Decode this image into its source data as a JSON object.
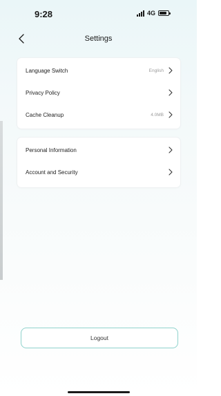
{
  "status_bar": {
    "time": "9:28",
    "network": "4G",
    "signal_icon": "signal-icon",
    "battery_icon": "battery-icon"
  },
  "header": {
    "title": "Settings",
    "back_icon": "chevron-left-icon"
  },
  "groups": [
    {
      "items": [
        {
          "label": "Language Switch",
          "value": "English"
        },
        {
          "label": "Privacy Policy",
          "value": ""
        },
        {
          "label": "Cache Cleanup",
          "value": "4.0MB"
        }
      ]
    },
    {
      "items": [
        {
          "label": "Personal Information",
          "value": ""
        },
        {
          "label": "Account and Security",
          "value": ""
        }
      ]
    }
  ],
  "logout_label": "Logout",
  "colors": {
    "accent_border": "#8fd2cc",
    "background_top": "#eaf6f8"
  }
}
